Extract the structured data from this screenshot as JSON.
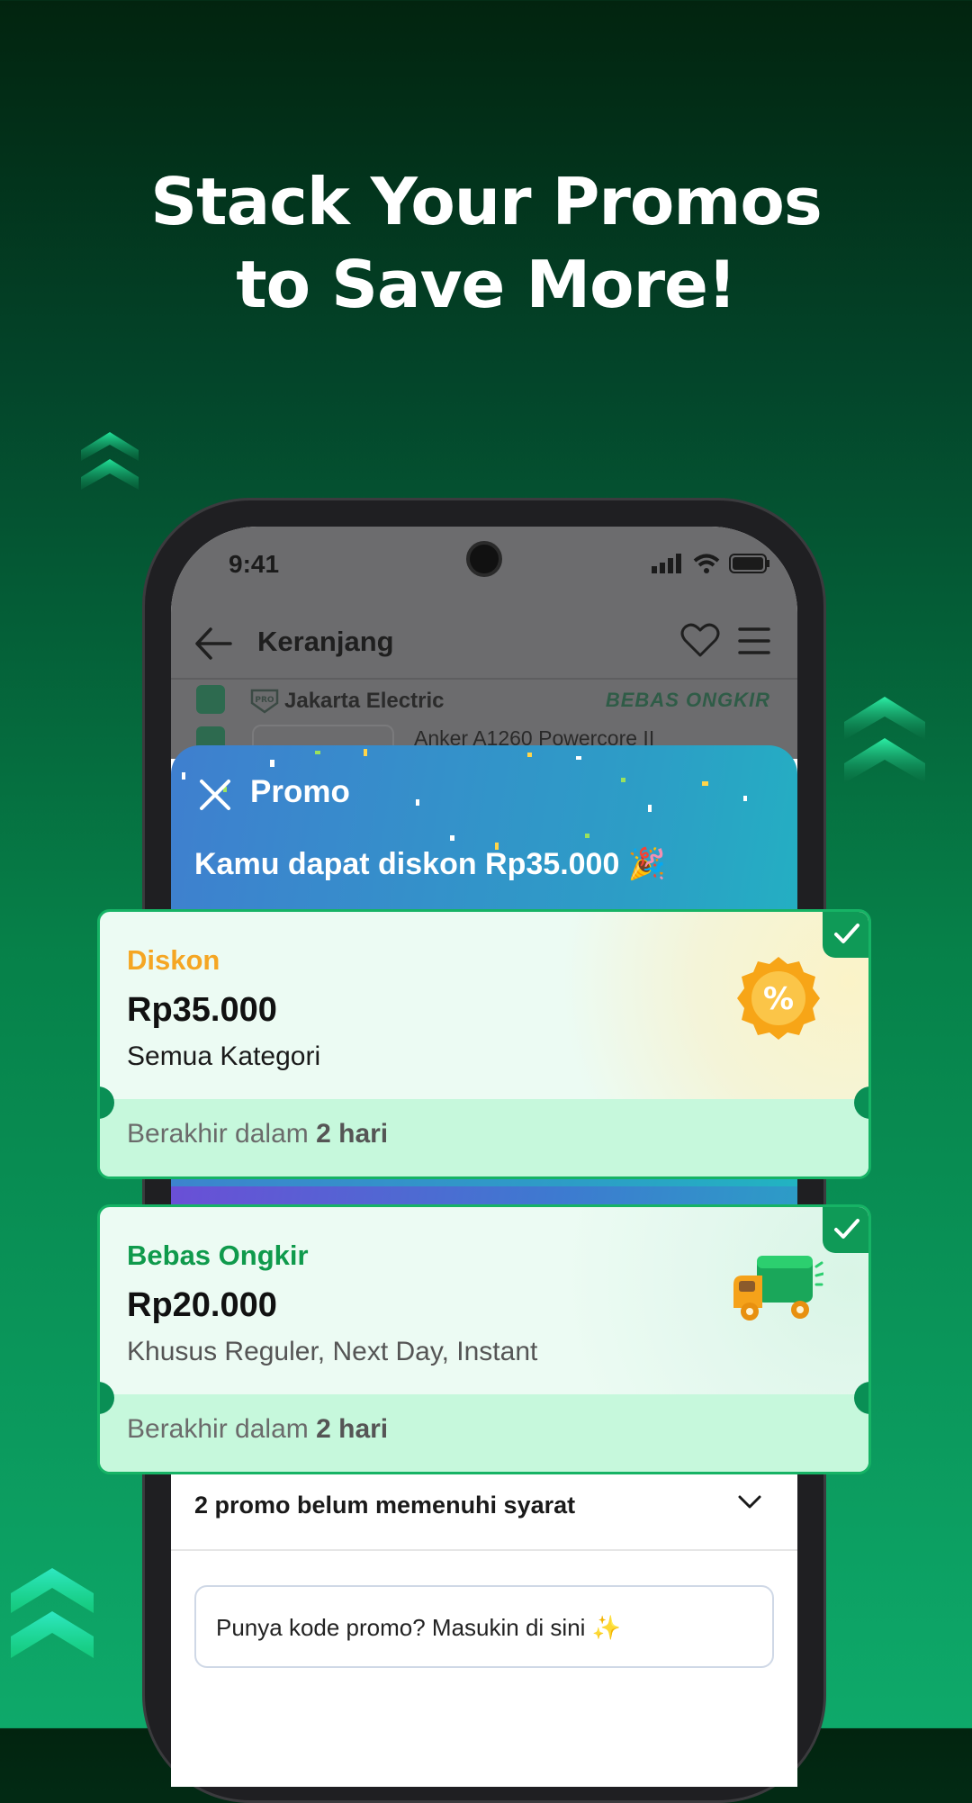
{
  "headline": {
    "line1": "Stack Your Promos",
    "line2": "to Save More!"
  },
  "status_bar": {
    "time": "9:41"
  },
  "cart_header": {
    "title": "Keranjang"
  },
  "store": {
    "name": "Jakarta Electric",
    "badge": "PRO",
    "shipping_tag": "BEBAS ONGKIR"
  },
  "product": {
    "name": "Anker A1260 Powercore II"
  },
  "promo_sheet": {
    "title": "Promo",
    "subtitle": "Kamu dapat diskon Rp35.000 🎉",
    "vouchers": [
      {
        "type": "Diskon",
        "type_color": "#f5a623",
        "amount": "Rp35.000",
        "scope": "Semua Kategori",
        "expiry_prefix": "Berakhir dalam ",
        "expiry_value": "2 hari",
        "icon": "discount-percent-icon",
        "selected": true
      },
      {
        "type": "Bebas Ongkir",
        "type_color": "#0f9a4c",
        "amount": "Rp20.000",
        "scope": "Khusus Reguler, Next Day, Instant",
        "expiry_prefix": "Berakhir dalam ",
        "expiry_value": "2 hari",
        "icon": "delivery-truck-icon",
        "selected": true
      }
    ],
    "unmet_label": "2 promo belum memenuhi syarat",
    "code_placeholder": "Punya kode promo? Masukin di sini ✨"
  }
}
